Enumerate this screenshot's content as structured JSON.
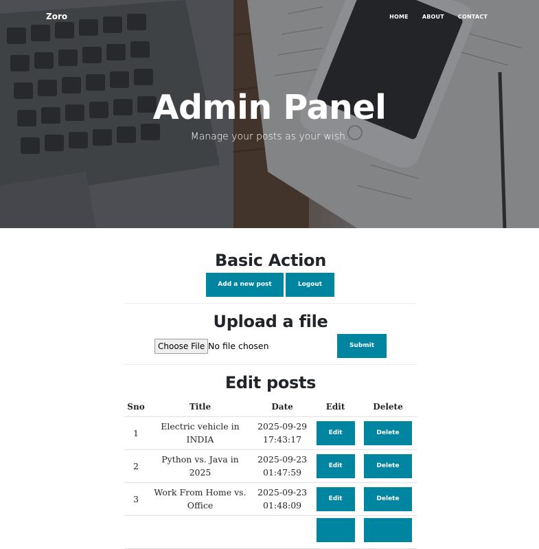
{
  "nav": {
    "brand": "Zoro",
    "links": [
      {
        "label": "HOME"
      },
      {
        "label": "ABOUT"
      },
      {
        "label": "CONTACT"
      }
    ]
  },
  "hero": {
    "title": "Admin Panel",
    "subtitle": "Manage your posts as your wish."
  },
  "basic": {
    "title": "Basic Action",
    "add_label": "Add a new post",
    "logout_label": "Logout"
  },
  "upload": {
    "title": "Upload a file",
    "choose_label": "Choose File",
    "status": "No file chosen",
    "submit_label": "Submit"
  },
  "posts": {
    "title": "Edit posts",
    "columns": [
      "Sno",
      "Title",
      "Date",
      "Edit",
      "Delete"
    ],
    "edit_label": "Edit",
    "delete_label": "Delete",
    "rows": [
      {
        "sno": "1",
        "title_line1": "Electric vehicle in",
        "title_line2": "INDIA",
        "date_line1": "2025-09-29",
        "date_line2": "17:43:17"
      },
      {
        "sno": "2",
        "title_line1": "Python vs. Java in",
        "title_line2": "2025",
        "date_line1": "2025-09-23",
        "date_line2": "01:47:59"
      },
      {
        "sno": "3",
        "title_line1": "Work From Home vs.",
        "title_line2": "Office",
        "date_line1": "2025-09-23",
        "date_line2": "01:48:09"
      }
    ]
  },
  "colors": {
    "accent": "#0085a1",
    "text": "#212529"
  }
}
